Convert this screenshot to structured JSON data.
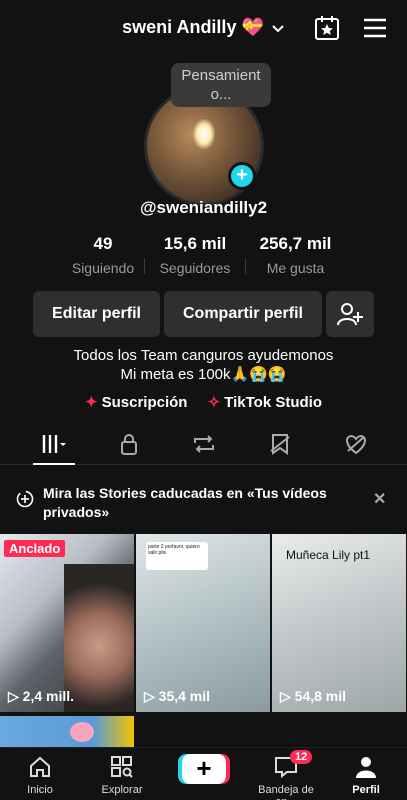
{
  "header": {
    "title": "sweni Andilly",
    "title_emoji": "💝"
  },
  "profile": {
    "thought_bubble": "Pensamient o...",
    "username": "@sweniandilly2",
    "stats": [
      {
        "value": "49",
        "label": "Siguiendo"
      },
      {
        "value": "15,6 mil",
        "label": "Seguidores"
      },
      {
        "value": "256,7 mil",
        "label": "Me gusta"
      }
    ],
    "buttons": {
      "edit": "Editar perfil",
      "share": "Compartir perfil"
    },
    "bio_line1": "Todos los Team canguros ayudemonos",
    "bio_line2": "Mi meta es 100k🙏😭😭",
    "links": {
      "subscription": "Suscripción",
      "studio": "TikTok Studio"
    }
  },
  "banner": {
    "text": "Mira las Stories caducadas en «Tus vídeos privados»"
  },
  "videos": [
    {
      "views": "2,4 mill.",
      "pinned_label": "Anclado"
    },
    {
      "views": "35,4 mil",
      "caption": "parte 2 porfavor, quiero salir plis"
    },
    {
      "views": "54,8 mil",
      "caption": "Muñeca Lily pt1"
    }
  ],
  "bottom_nav": [
    {
      "label": "Inicio"
    },
    {
      "label": "Explorar"
    },
    {
      "label": ""
    },
    {
      "label": "Bandeja de en...",
      "badge": "12"
    },
    {
      "label": "Perfil"
    }
  ],
  "colors": {
    "accent_red": "#fe2c55",
    "accent_cyan": "#20d5ec",
    "background": "#121212"
  }
}
